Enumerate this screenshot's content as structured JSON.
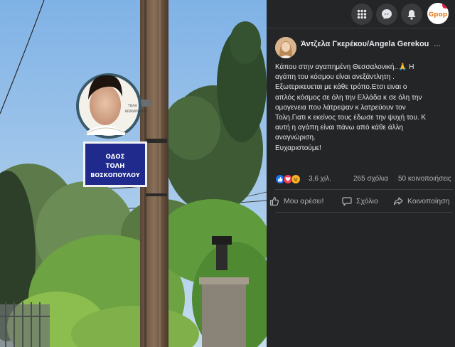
{
  "post": {
    "author": "Άντζελα Γκερέκου/Angela Gerekou",
    "more": "...",
    "lines": [
      "Κάπου στην αγαπημένη Θεσσαλονική..🙏 Η",
      "αγάπη του κόσμου είναι ανεξάντλητη .",
      "Εξωτερικευεται με κάθε τρόπο.Ετσι ειναι ο",
      "απλός κόσμος σε όλη την Ελλάδα κ σε όλη την",
      "ομογενεια που λάτρεψαν κ λατρεύουν τον",
      "Τολη.Γιατι κ εκείνος τους έδωσε την ψυχή του. Κ",
      "αυτή η αγάπη είναι πάνω από κάθε άλλη",
      "αναγνώριση.",
      "Ευχαριστούμε!"
    ]
  },
  "stats": {
    "reactions": "3,6 χιλ.",
    "comments": "265 σχόλια",
    "shares": "50 κοινοποιήσεις"
  },
  "actions": {
    "like": "Μου αρέσει!",
    "comment": "Σχόλιο",
    "share": "Κοινοποίηση"
  },
  "topbar": {
    "logo_text": "Gpop"
  },
  "photo": {
    "sign_line1": "ΟΔΟΣ",
    "sign_line2": "ΤΟΛΗ",
    "sign_line3": "ΒΟΣΚΟΠΟΥΛΟΥ"
  },
  "colors": {
    "panel_bg": "#242526",
    "text_primary": "#e4e6eb",
    "text_secondary": "#b0b3b8",
    "like_blue": "#1877f2",
    "love_red": "#f33e58",
    "haha_yellow": "#f7b125",
    "sign_blue": "#1f2a8c"
  }
}
